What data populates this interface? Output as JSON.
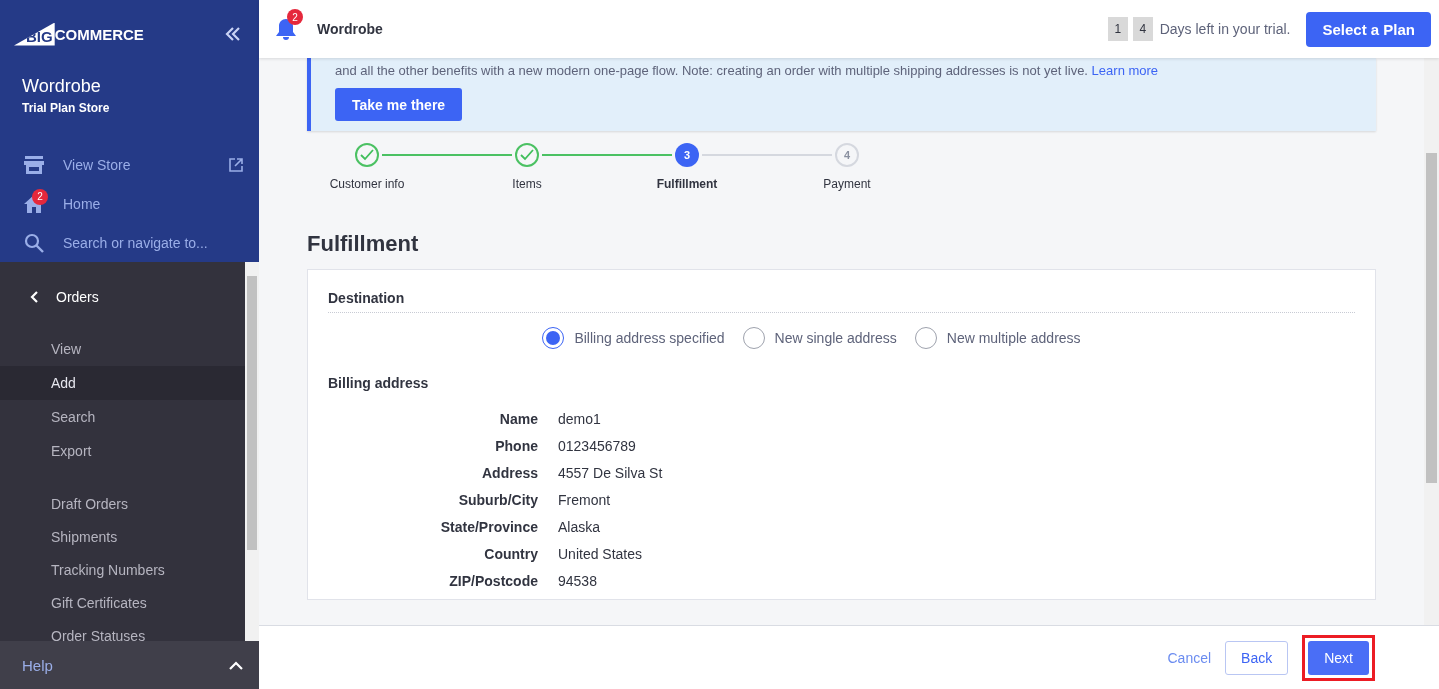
{
  "sidebar": {
    "logo": {
      "part_1": "BIG",
      "part_2": "COMMERCE"
    },
    "store_name": "Wordrobe",
    "store_plan": "Trial Plan Store",
    "nav_items": [
      {
        "kind": "store",
        "label": "View Store",
        "external": true
      },
      {
        "kind": "home",
        "label": "Home",
        "badge": "2"
      },
      {
        "kind": "search",
        "label": "Search or navigate to..."
      }
    ],
    "section": {
      "title": "Orders",
      "groups": [
        [
          {
            "label": "View",
            "selected": false
          },
          {
            "label": "Add",
            "selected": true
          },
          {
            "label": "Search",
            "selected": false
          },
          {
            "label": "Export",
            "selected": false
          }
        ],
        [
          {
            "label": "Draft Orders",
            "selected": false
          },
          {
            "label": "Shipments",
            "selected": false
          },
          {
            "label": "Tracking Numbers",
            "selected": false
          },
          {
            "label": "Gift Certificates",
            "selected": false
          },
          {
            "label": "Order Statuses",
            "selected": false
          }
        ]
      ]
    },
    "help": "Help"
  },
  "header": {
    "notification_count": "2",
    "store_name": "Wordrobe",
    "trial_digits": [
      "1",
      "4"
    ],
    "trial_text": "Days left in your trial.",
    "plan_button": "Select a Plan"
  },
  "banner": {
    "text": "and all the other benefits with a new modern one-page flow. Note: creating an order with multiple shipping addresses is not yet live.",
    "link": "Learn more",
    "button": "Take me there"
  },
  "steps": [
    {
      "label": "Customer info",
      "completed": true,
      "selected": false
    },
    {
      "label": "Items",
      "completed": true,
      "selected": false
    },
    {
      "number": "3",
      "label": "Fulfillment",
      "completed": false,
      "selected": true
    },
    {
      "number": "4",
      "label": "Payment",
      "completed": false,
      "selected": false
    }
  ],
  "page_title": "Fulfillment",
  "destination": {
    "title": "Destination",
    "options": [
      {
        "label": "Billing address specified",
        "selected": true
      },
      {
        "label": "New single address",
        "selected": false
      },
      {
        "label": "New multiple address",
        "selected": false
      }
    ]
  },
  "billing": {
    "title": "Billing address",
    "fields": [
      {
        "label": "Name",
        "value": "demo1"
      },
      {
        "label": "Phone",
        "value": "0123456789"
      },
      {
        "label": "Address",
        "value": "4557 De Silva St"
      },
      {
        "label": "Suburb/City",
        "value": "Fremont"
      },
      {
        "label": "State/Province",
        "value": "Alaska"
      },
      {
        "label": "Country",
        "value": "United States"
      },
      {
        "label": "ZIP/Postcode",
        "value": "94538"
      }
    ]
  },
  "footer": {
    "cancel": "Cancel",
    "back": "Back",
    "next": "Next",
    "next_highlighted": true
  }
}
